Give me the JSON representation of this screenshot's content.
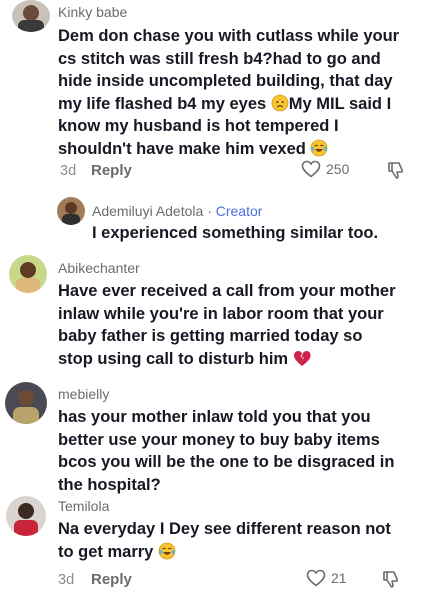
{
  "colors": {
    "creator": "#4a6fdc",
    "text": "#161823",
    "muted": "#6b6b70",
    "heart": "#d0234a"
  },
  "comments": [
    {
      "username": "Kinky babe",
      "lines": [
        "Dem don chase you with cutlass while your",
        "cs stitch was still fresh b4?had to go and",
        "hide inside uncompleted building, that day",
        "my life flashed b4 my eyes",
        "My MIL said I",
        "know my husband is hot tempered I",
        "shouldn't have make him vexed"
      ],
      "time": "3d",
      "reply_label": "Reply",
      "likes": "250"
    },
    {
      "username": "Ademiluyi Adetola",
      "separator": "·",
      "creator_label": "Creator",
      "lines": [
        "I experienced something similar too."
      ]
    },
    {
      "username": "Abikechanter",
      "lines": [
        "Have ever received a call from your mother",
        "inlaw while you're in labor room that your",
        "baby father is getting married today so",
        "stop using call to disturb him"
      ]
    },
    {
      "username": "mebielly",
      "lines": [
        "has your mother inlaw told you that you",
        "better use your money to buy baby items",
        "bcos you will be the one to be disgraced in",
        "the hospital?"
      ]
    },
    {
      "username": "Temilola",
      "lines": [
        "Na everyday I Dey see different reason not",
        "to get marry"
      ],
      "time": "3d",
      "reply_label": "Reply",
      "likes": "21"
    }
  ]
}
